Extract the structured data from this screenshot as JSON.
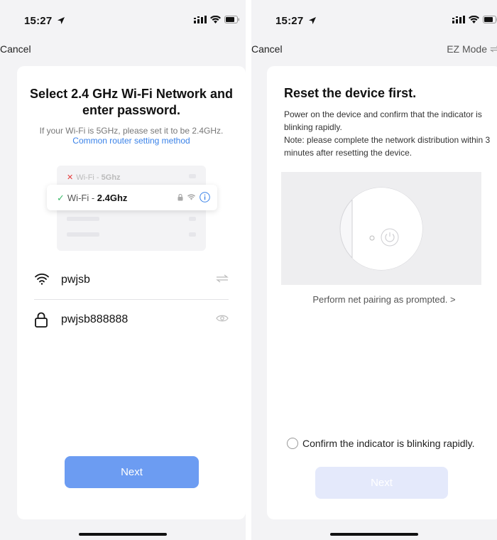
{
  "left": {
    "status": {
      "time": "15:27"
    },
    "nav": {
      "cancel": "Cancel"
    },
    "title": "Select 2.4 GHz Wi-Fi Network and enter password.",
    "subtitle": "If your Wi-Fi is 5GHz, please set it to be 2.4GHz.",
    "link": "Common router setting method",
    "illustration": {
      "row_5ghz": {
        "prefix": "Wi-Fi - ",
        "band": "5Ghz"
      },
      "row_24ghz": {
        "prefix": "Wi-Fi - ",
        "band": "2.4Ghz"
      }
    },
    "wifi_name": "pwjsb",
    "password": "pwjsb888888",
    "next": "Next"
  },
  "right": {
    "status": {
      "time": "15:27"
    },
    "nav": {
      "cancel": "Cancel",
      "mode": "EZ Mode"
    },
    "title": "Reset the device first.",
    "body_line1": "Power on the device and confirm that the indicator is blinking rapidly.",
    "body_line2": "Note: please complete the network distribution within 3 minutes after resetting the device.",
    "prompt": "Perform net pairing as prompted. >",
    "confirm": "Confirm the indicator is blinking rapidly.",
    "next": "Next"
  },
  "icons": [
    "location-arrow-icon",
    "signal-icon",
    "wifi-icon",
    "battery-icon",
    "switch-icon",
    "lock-icon",
    "eye-icon",
    "info-icon",
    "check-icon",
    "close-icon",
    "power-icon"
  ],
  "colors": {
    "accent": "#3a82e8",
    "button": "#6c9cf2",
    "button_disabled": "#e4e9fb",
    "success": "#3cba6a",
    "error": "#e53c3c"
  }
}
